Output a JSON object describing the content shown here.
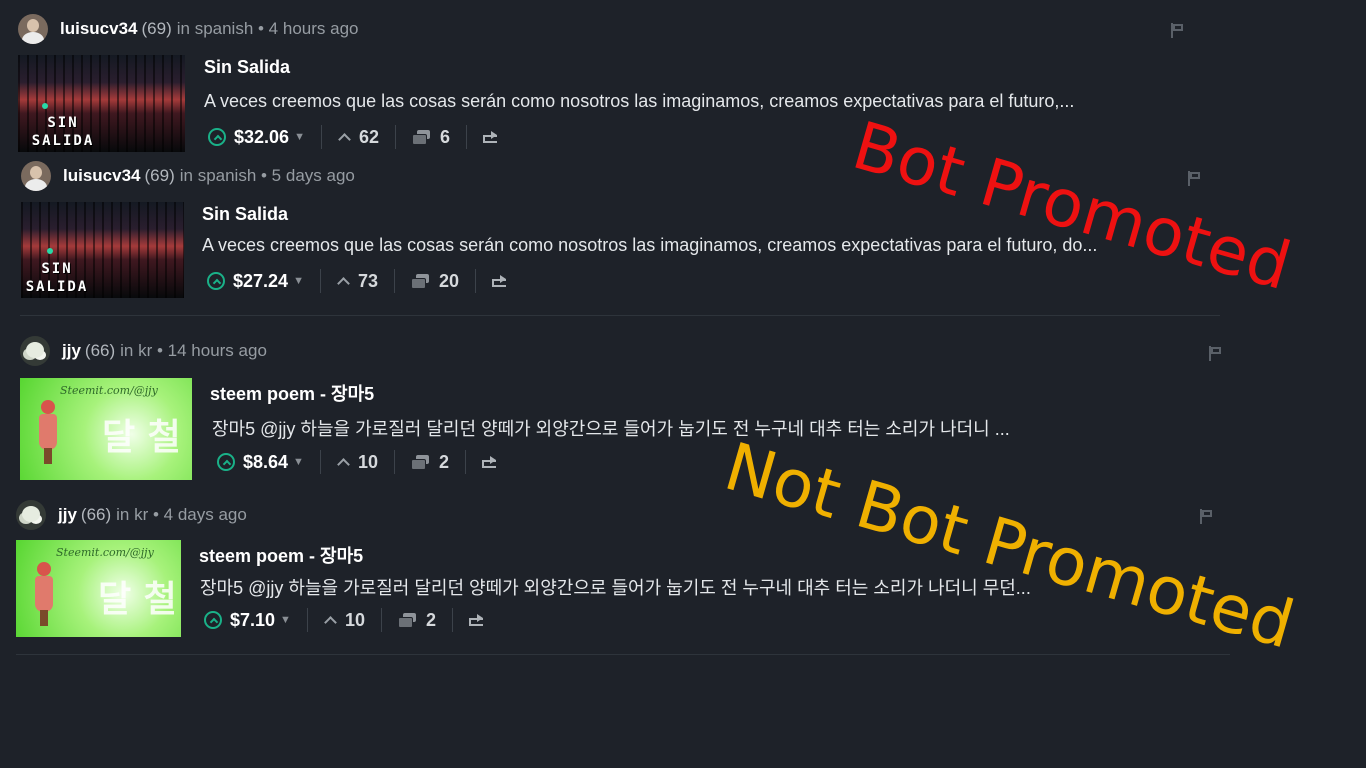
{
  "posts": [
    {
      "author": "luisucv34",
      "reputation": "(69)",
      "meta": "in spanish • 4 hours ago",
      "avatar_icon": "person-avatar-icon",
      "title": "Sin Salida",
      "summary": "A veces creemos que las cosas serán como nosotros las imaginamos, creamos expectativas para el futuro,...",
      "thumbnail_text": "SIN SALIDA",
      "payout": "$32.06",
      "votes": "62",
      "comments": "6"
    },
    {
      "author": "luisucv34",
      "reputation": "(69)",
      "meta": "in spanish • 5 days ago",
      "avatar_icon": "person-avatar-icon",
      "title": "Sin Salida",
      "summary": "A veces creemos que las cosas serán como nosotros las imaginamos, creamos expectativas para el futuro, do...",
      "thumbnail_text": "SIN SALIDA",
      "payout": "$27.24",
      "votes": "73",
      "comments": "20"
    },
    {
      "author": "jjy",
      "reputation": "(66)",
      "meta": "in kr • 14 hours ago",
      "avatar_icon": "flower-avatar-icon",
      "title": "steem poem - 장마5",
      "summary": "장마5 @jjy 하늘을 가로질러 달리던 양떼가 외양간으로 들어가 눕기도 전 누구네 대추 터는 소리가 나더니 ...",
      "thumbnail_text": "Steemit.com/@jjy",
      "payout": "$8.64",
      "votes": "10",
      "comments": "2"
    },
    {
      "author": "jjy",
      "reputation": "(66)",
      "meta": "in kr • 4 days ago",
      "avatar_icon": "flower-avatar-icon",
      "title": "steem poem - 장마5",
      "summary": "장마5 @jjy 하늘을 가로질러 달리던 양떼가 외양간으로 들어가 눕기도 전 누구네 대추 터는 소리가 나더니 무던...",
      "thumbnail_text": "Steemit.com/@jjy",
      "payout": "$7.10",
      "votes": "10",
      "comments": "2"
    }
  ],
  "overlays": {
    "bot_label": "Bot Promoted",
    "not_bot_label": "Not Bot Promoted"
  },
  "colors": {
    "background": "#1e2229",
    "upvote_accent": "#1ab188",
    "bot_label": "#ee1111",
    "not_bot_label": "#efb000"
  }
}
